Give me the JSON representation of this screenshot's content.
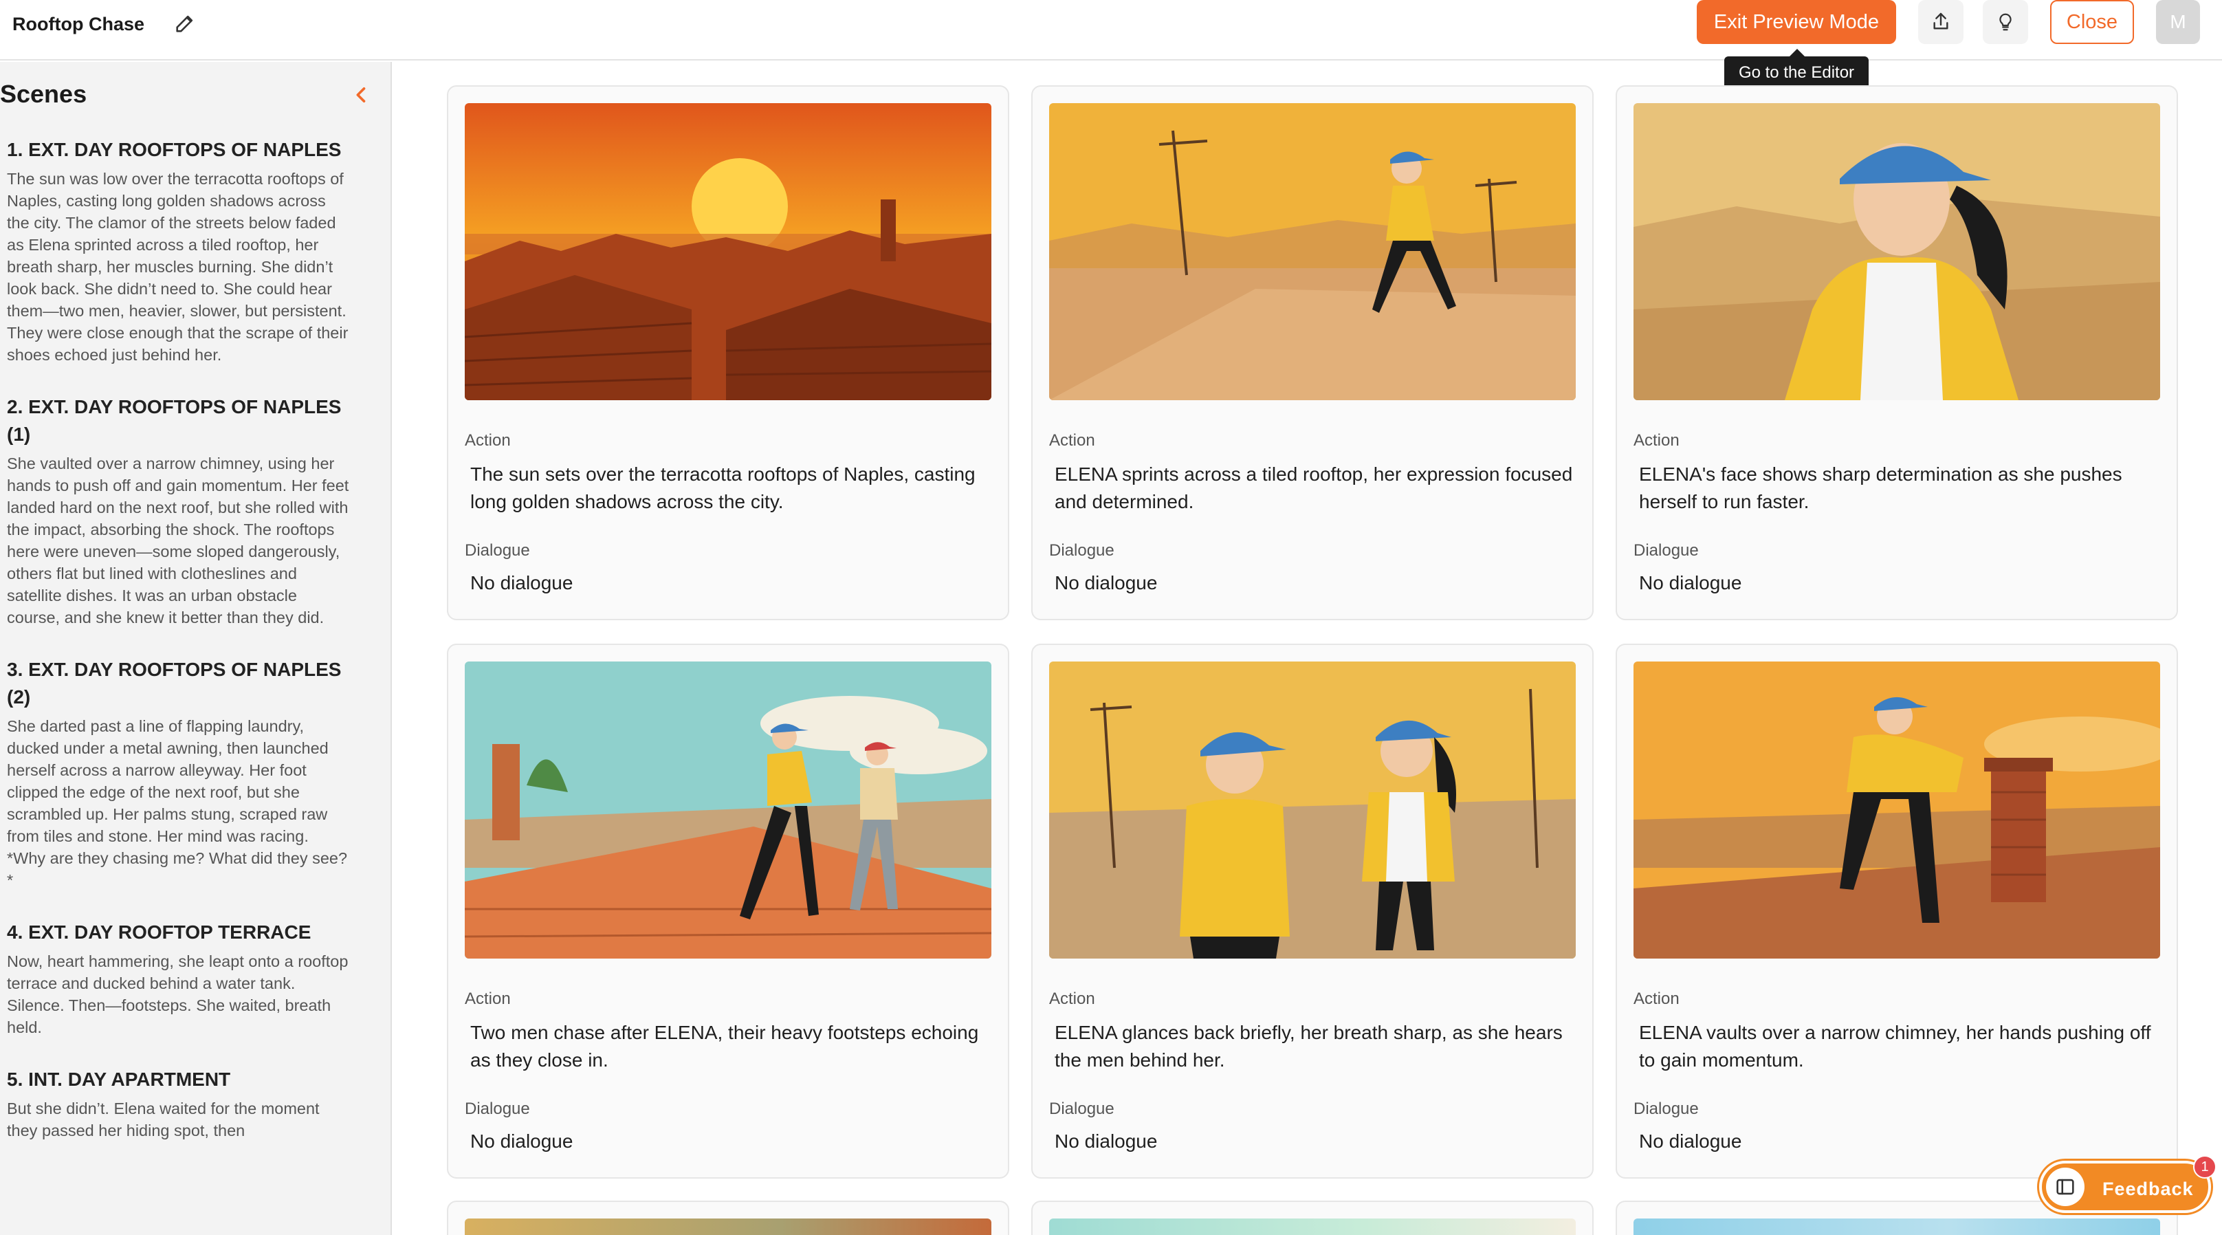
{
  "header": {
    "title": "Rooftop Chase",
    "exit_preview_label": "Exit Preview Mode",
    "tooltip": "Go to the Editor",
    "close_label": "Close",
    "avatar_initial": "M",
    "accent_color": "#f26a2a"
  },
  "sidebar": {
    "title": "Scenes",
    "scenes": [
      {
        "heading": "1. EXT. DAY ROOFTOPS OF NAPLES",
        "text": "The sun was low over the terracotta rooftops of Naples, casting long golden shadows across the city. The clamor of the streets below faded as Elena sprinted across a tiled rooftop, her breath sharp, her muscles burning. She didn’t look back. She didn’t need to. She could hear them—two men, heavier, slower, but persistent. They were close enough that the scrape of their shoes echoed just behind her."
      },
      {
        "heading": "2. EXT. DAY ROOFTOPS OF NAPLES (1)",
        "text": "She vaulted over a narrow chimney, using her hands to push off and gain momentum. Her feet landed hard on the next roof, but she rolled with the impact, absorbing the shock. The rooftops here were uneven—some sloped dangerously, others flat but lined with clotheslines and satellite dishes. It was an urban obstacle course, and she knew it better than they did."
      },
      {
        "heading": "3. EXT. DAY ROOFTOPS OF NAPLES (2)",
        "text": "She darted past a line of flapping laundry, ducked under a metal awning, then launched herself across a narrow alleyway. Her foot clipped the edge of the next roof, but she scrambled up. Her palms stung, scraped raw from tiles and stone. Her mind was racing. *Why are they chasing me? What did they see?*"
      },
      {
        "heading": "4. EXT. DAY ROOFTOP TERRACE",
        "text": "Now, heart hammering, she leapt onto a rooftop terrace and ducked behind a water tank. Silence. Then—footsteps. She waited, breath held."
      },
      {
        "heading": "5. INT. DAY APARTMENT",
        "text": "But she didn’t. Elena waited for the moment they passed her hiding spot, then"
      }
    ]
  },
  "cards": [
    {
      "action_label": "Action",
      "action": "The sun sets over the terracotta rooftops of Naples, casting long golden shadows across the city.",
      "dialogue_label": "Dialogue",
      "dialogue": "No dialogue"
    },
    {
      "action_label": "Action",
      "action": "ELENA sprints across a tiled rooftop, her expression focused and determined.",
      "dialogue_label": "Dialogue",
      "dialogue": "No dialogue"
    },
    {
      "action_label": "Action",
      "action": "ELENA's face shows sharp determination as she pushes herself to run faster.",
      "dialogue_label": "Dialogue",
      "dialogue": "No dialogue"
    },
    {
      "action_label": "Action",
      "action": "Two men chase after ELENA, their heavy footsteps echoing as they close in.",
      "dialogue_label": "Dialogue",
      "dialogue": "No dialogue"
    },
    {
      "action_label": "Action",
      "action": "ELENA glances back briefly, her breath sharp, as she hears the men behind her.",
      "dialogue_label": "Dialogue",
      "dialogue": "No dialogue"
    },
    {
      "action_label": "Action",
      "action": "ELENA vaults over a narrow chimney, her hands pushing off to gain momentum.",
      "dialogue_label": "Dialogue",
      "dialogue": "No dialogue"
    }
  ],
  "feedback": {
    "label": "Feedback",
    "badge_count": "1",
    "color": "#f28a24"
  }
}
